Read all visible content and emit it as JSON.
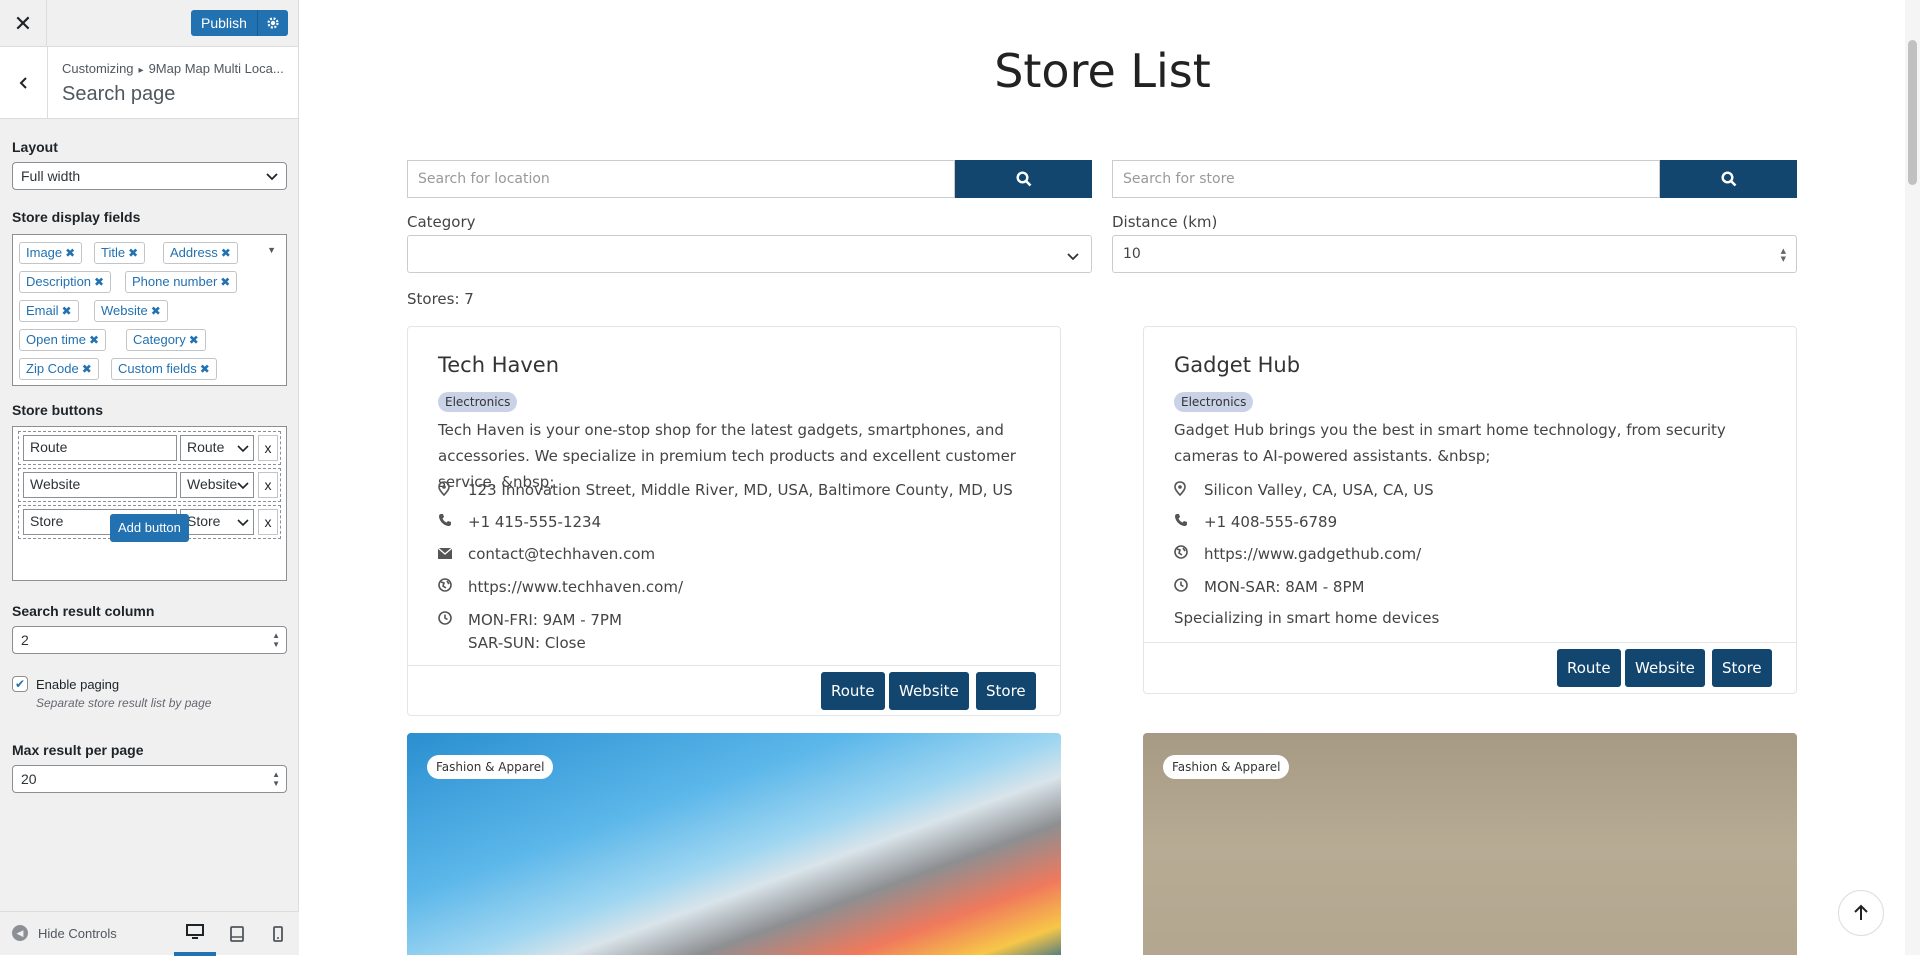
{
  "panel": {
    "close_icon": "close-icon",
    "publish_label": "Publish",
    "breadcrumb_root": "Customizing",
    "breadcrumb_section": "9Map Map Multi Loca...",
    "section_title": "Search page",
    "layout": {
      "label": "Layout",
      "value": "Full width"
    },
    "display_fields": {
      "label": "Store display fields",
      "tags": [
        "Image",
        "Title",
        "Address",
        "Description",
        "Phone number",
        "Email",
        "Website",
        "Open time",
        "Category",
        "Zip Code",
        "Custom fields"
      ]
    },
    "store_buttons": {
      "label": "Store buttons",
      "rows": [
        {
          "text": "Route",
          "type": "Route"
        },
        {
          "text": "Website",
          "type": "Website"
        },
        {
          "text": "Store",
          "type": "Store"
        }
      ],
      "remove_label": "x",
      "add_label": "Add button"
    },
    "result_column": {
      "label": "Search result column",
      "value": "2"
    },
    "paging": {
      "label": "Enable paging",
      "checked": true,
      "description": "Separate store result list by page"
    },
    "max_per_page": {
      "label": "Max result per page",
      "value": "20"
    },
    "hide_controls": "Hide Controls"
  },
  "preview": {
    "title": "Store List",
    "location_placeholder": "Search for location",
    "store_placeholder": "Search for store",
    "category_label": "Category",
    "category_value": "",
    "distance_label": "Distance (km)",
    "distance_value": "10",
    "stores_count": "Stores: 7",
    "cards": [
      {
        "name": "Tech Haven",
        "category": "Electronics",
        "description": "Tech Haven is your one-stop shop for the latest gadgets, smartphones, and accessories. We specialize in premium tech products and excellent customer service. &nbsp;",
        "address": "123 Innovation Street, Middle River, MD, USA, Baltimore County, MD, US",
        "phone": "+1 415-555-1234",
        "email": "contact@techhaven.com",
        "website": "https://www.techhaven.com/",
        "hours1": "MON-FRI: 9AM - 7PM",
        "hours2": "SAR-SUN: Close",
        "buttons": [
          "Route",
          "Website",
          "Store"
        ]
      },
      {
        "name": "Gadget Hub",
        "category": "Electronics",
        "description": "Gadget Hub brings you the best in smart home technology, from security cameras to AI-powered assistants. &nbsp;",
        "address": "Silicon Valley, CA, USA, CA, US",
        "phone": "+1 408-555-6789",
        "website": "https://www.gadgethub.com/",
        "hours1": "MON-SAR: 8AM - 8PM",
        "extra": "Specializing in smart home devices",
        "buttons": [
          "Route",
          "Website",
          "Store"
        ]
      }
    ],
    "image_cards": [
      {
        "category": "Fashion & Apparel"
      },
      {
        "category": "Fashion & Apparel"
      }
    ]
  },
  "colors": {
    "accent": "#2271b1",
    "store_button": "#13466f",
    "badge": "#c9d2e6"
  }
}
